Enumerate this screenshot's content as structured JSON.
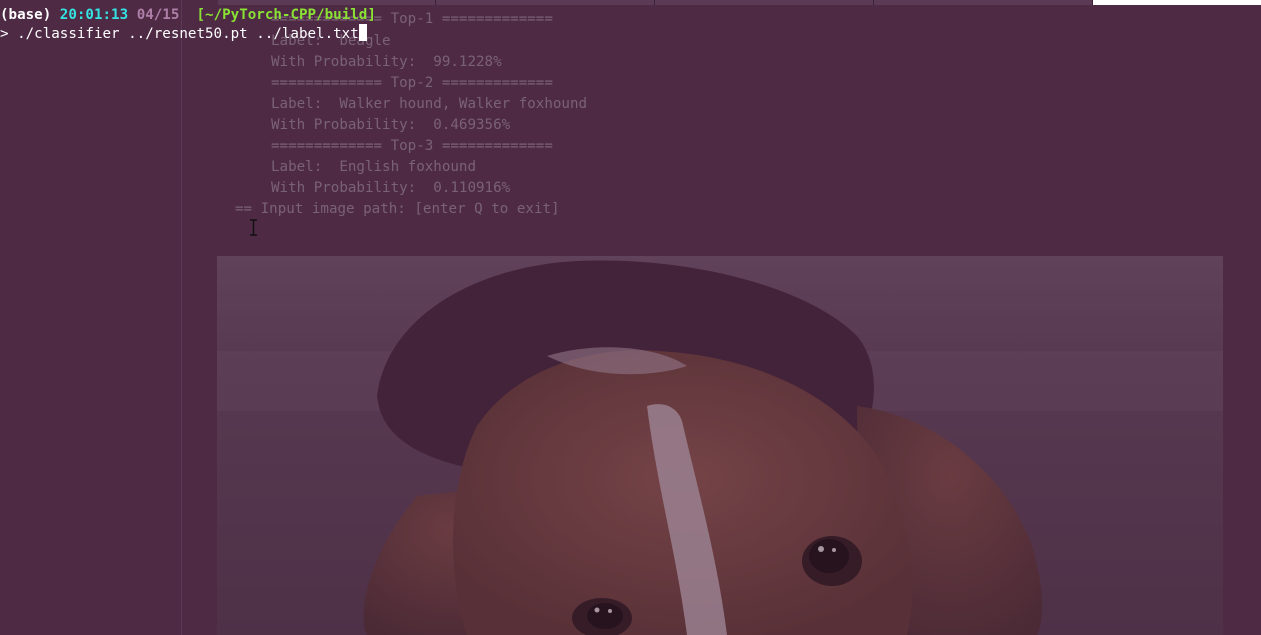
{
  "prompt": {
    "env": "(base)",
    "time": "20:01:13",
    "date": "04/15",
    "cwd": "[~/PyTorch-CPP/build]",
    "symbol": ">",
    "command": "./classifier ../resnet50.pt ../label.txt"
  },
  "background_output": {
    "lines": [
      {
        "id": "top1-header",
        "text": "============= Top-1 ============="
      },
      {
        "id": "top1-label",
        "text": "Label:  beagle"
      },
      {
        "id": "top1-prob",
        "text": "With Probability:  99.1228%"
      },
      {
        "id": "top2-header",
        "text": "============= Top-2 ============="
      },
      {
        "id": "top2-label",
        "text": "Label:  Walker hound, Walker foxhound"
      },
      {
        "id": "top2-prob",
        "text": "With Probability:  0.469356%"
      },
      {
        "id": "top3-header",
        "text": "============= Top-3 ============="
      },
      {
        "id": "top3-label",
        "text": "Label:  English foxhound"
      },
      {
        "id": "top3-prob",
        "text": "With Probability:  0.110916%"
      },
      {
        "id": "input-prompt",
        "text": "== Input image path: [enter Q to exit]"
      }
    ]
  },
  "photo": {
    "subject": "beagle-puppy"
  },
  "icons": {
    "text_cursor": "i-beam-cursor-icon"
  },
  "colors": {
    "terminal_bg": "#4e2a45",
    "prompt_time": "#34e2e2",
    "prompt_date": "#ad7fa8",
    "prompt_dir": "#8ae234",
    "faded_text": "#7a6276"
  }
}
